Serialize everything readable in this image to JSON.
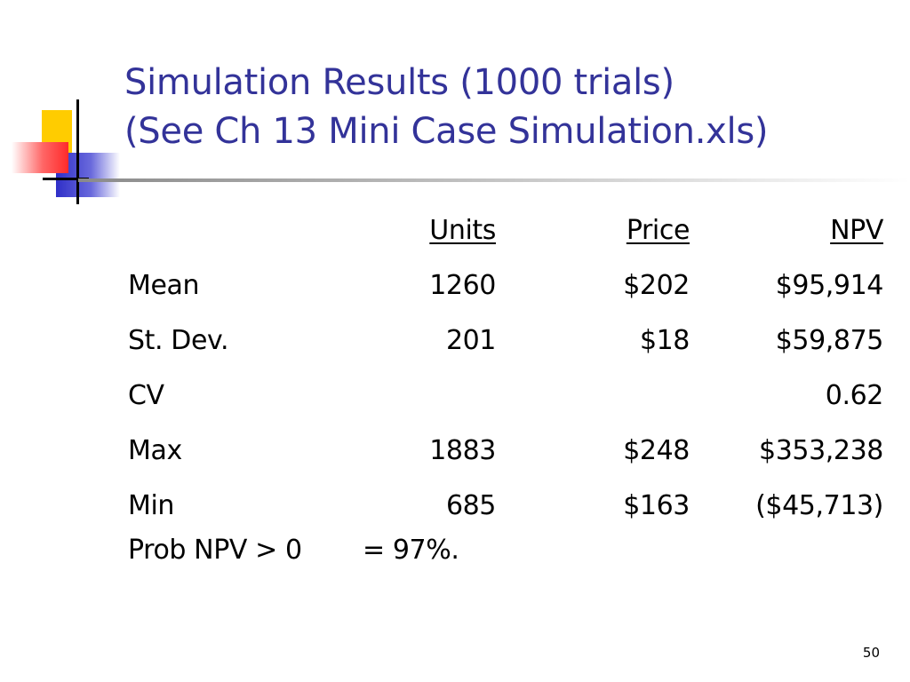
{
  "colors": {
    "title": "#333399",
    "accent_yellow": "#ffcc00",
    "accent_red": "#ff3333",
    "accent_blue": "#3333cc",
    "text": "#000000"
  },
  "slide": {
    "title_line1": "Simulation Results (1000 trials)",
    "title_line2": "(See Ch 13 Mini Case Simulation.xls)",
    "page_number": "50"
  },
  "table": {
    "headers": [
      "",
      "Units",
      "Price",
      "NPV"
    ],
    "rows": [
      {
        "label": "Mean",
        "units": "1260",
        "price": "$202",
        "npv": "$95,914"
      },
      {
        "label": "St. Dev.",
        "units": "201",
        "price": "$18",
        "npv": "$59,875"
      },
      {
        "label": "CV",
        "units": "",
        "price": "",
        "npv": "0.62"
      },
      {
        "label": "Max",
        "units": "1883",
        "price": "$248",
        "npv": "$353,238"
      },
      {
        "label": "Min",
        "units": "685",
        "price": "$163",
        "npv": "($45,713)"
      }
    ]
  },
  "probability": {
    "label": "Prob NPV > 0",
    "value": "= 97%."
  }
}
